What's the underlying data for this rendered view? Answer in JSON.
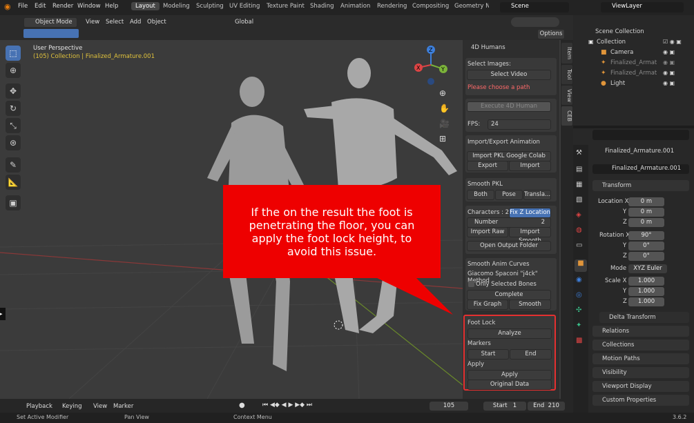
{
  "topbar": {
    "menus": [
      "File",
      "Edit",
      "Render",
      "Window",
      "Help"
    ],
    "workspaces": [
      "Layout",
      "Modeling",
      "Sculpting",
      "UV Editing",
      "Texture Paint",
      "Shading",
      "Animation",
      "Rendering",
      "Compositing",
      "Geometry No"
    ],
    "scene": "Scene",
    "viewlayer": "ViewLayer"
  },
  "header": {
    "mode": "Object Mode",
    "menus": [
      "View",
      "Select",
      "Add",
      "Object"
    ],
    "transform": "Global",
    "options": "Options"
  },
  "viewport": {
    "perspective": "User Perspective",
    "collection": "(105) Collection | Finalized_Armature.001"
  },
  "callout": {
    "text": "If the on the result the foot is penetrating the floor, you can apply the foot lock height, to avoid this issue."
  },
  "npanel": {
    "title": "4D Humans",
    "select_images": "Select Images:",
    "select_video": "Select Video",
    "warning": "Please choose a path",
    "execute": "Execute 4D Human",
    "fps_label": "FPS:",
    "fps_value": "24",
    "import_export": "Import/Export Animation",
    "import_pkl": "Import PKL Google Colab",
    "export": "Export",
    "import": "Import",
    "smooth_pkl": "Smooth PKL",
    "both": "Both",
    "pose": "Pose",
    "transla": "Transla...",
    "characters": "Characters : 2",
    "fix_z": "Fix Z Location",
    "number_label": "Number",
    "number_value": "2",
    "import_raw": "Import Raw",
    "import_smooth": "Import Smooth",
    "open_output": "Open Output Folder",
    "smooth_anim": "Smooth Anim Curves",
    "method": "Giacomo Spaconi \"j4ck\" Method",
    "only_selected": "Only Selected Bones",
    "complete": "Complete",
    "fix_graph": "Fix Graph",
    "smooth": "Smooth",
    "foot_lock": "Foot Lock",
    "analyze": "Analyze",
    "markers": "Markers",
    "start": "Start",
    "end": "End",
    "apply_label": "Apply",
    "apply_btn": "Apply",
    "original_data": "Original Data"
  },
  "side_tabs": [
    "Item",
    "Tool",
    "View",
    "CEB"
  ],
  "outliner": {
    "scene_collection": "Scene Collection",
    "items": [
      "Collection",
      "Camera",
      "Finalized_Armat",
      "Finalized_Armat",
      "Light"
    ]
  },
  "properties": {
    "object_name": "Finalized_Armature.001",
    "data_name": "Finalized_Armature.001",
    "transform": "Transform",
    "location_label": "Location X",
    "y": "Y",
    "z": "Z",
    "loc": [
      "0 m",
      "0 m",
      "0 m"
    ],
    "rotation_label": "Rotation X",
    "rot": [
      "90°",
      "0°",
      "0°"
    ],
    "mode_label": "Mode",
    "mode_value": "XYZ Euler",
    "scale_label": "Scale X",
    "scale": [
      "1.000",
      "1.000",
      "1.000"
    ],
    "sections": [
      "Delta Transform",
      "Relations",
      "Collections",
      "Motion Paths",
      "Visibility",
      "Viewport Display",
      "Custom Properties"
    ]
  },
  "timeline": {
    "menus": [
      "Playback",
      "Keying",
      "View",
      "Marker"
    ],
    "frame": "105",
    "start_label": "Start",
    "start": "1",
    "end_label": "End",
    "end": "210"
  },
  "status": {
    "left": "Set Active Modifier",
    "middle": "Pan View",
    "right": "Context Menu",
    "version": "3.6.2"
  }
}
